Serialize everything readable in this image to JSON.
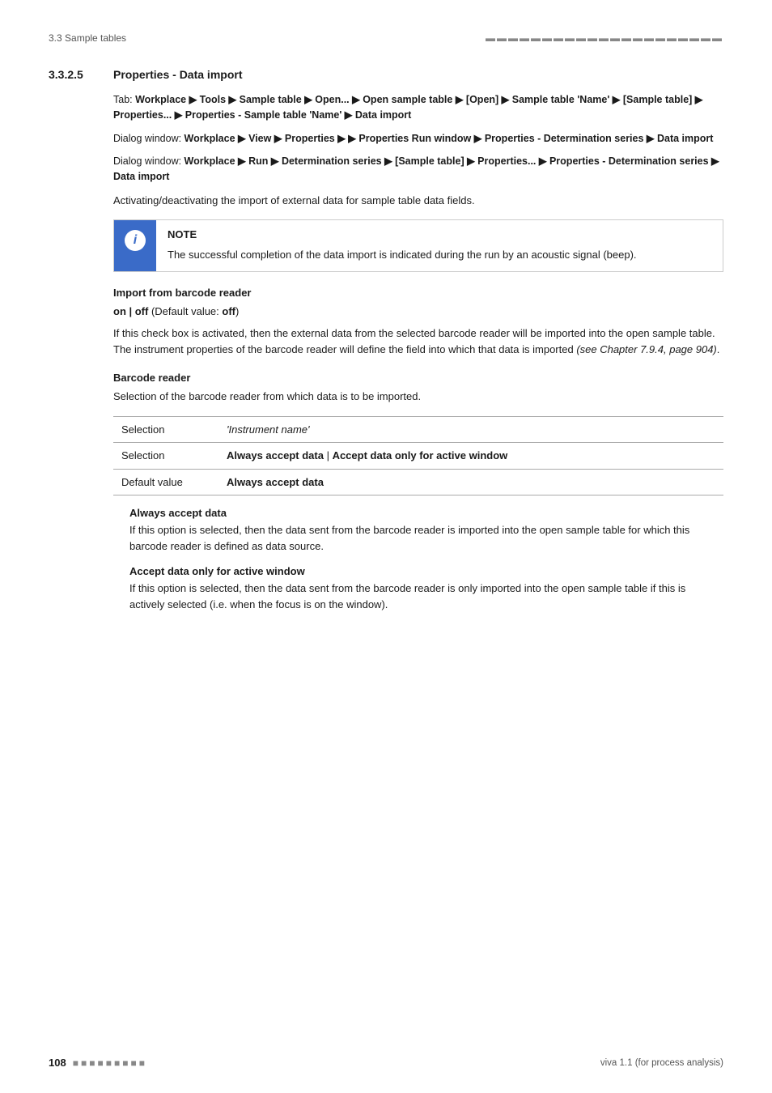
{
  "header": {
    "left": "3.3 Sample tables",
    "dots_count": 21
  },
  "section": {
    "number": "3.3.2.5",
    "title": "Properties - Data import"
  },
  "nav_paths": [
    {
      "prefix": "Tab: ",
      "content": "Workplace ▶ Tools ▶ Sample table ▶ Open... ▶ Open sample table ▶ [Open] ▶ Sample table 'Name' ▶ [Sample table] ▶ Properties... ▶ Properties - Sample table 'Name' ▶ Data import"
    },
    {
      "prefix": "Dialog window: ",
      "content": "Workplace ▶ View ▶ Properties ▶  ▶ Properties Run window ▶ Properties - Determination series ▶ Data import"
    },
    {
      "prefix": "Dialog window: ",
      "content": "Workplace ▶ Run ▶ Determination series ▶ [Sample table] ▶ Properties... ▶ Properties - Determination series ▶ Data import"
    }
  ],
  "description": "Activating/deactivating the import of external data for sample table data fields.",
  "note": {
    "title": "NOTE",
    "text": "The successful completion of the data import is indicated during the run by an acoustic signal (beep)."
  },
  "import_section": {
    "heading": "Import from barcode reader",
    "option_line": "on | off",
    "option_suffix": " (Default value: ",
    "default": "off",
    "option_close": ")",
    "description": "If this check box is activated, then the external data from the selected barcode reader will be imported into the open sample table. The instrument properties of the barcode reader will define the field into which that data is imported ",
    "see_ref": "(see Chapter 7.9.4, page 904)",
    "description_end": "."
  },
  "barcode_reader_section": {
    "heading": "Barcode reader",
    "description": "Selection of the barcode reader from which data is to be imported.",
    "table": [
      {
        "label": "Selection",
        "value": "'Instrument name'"
      },
      {
        "label": "Selection",
        "value": "Always accept data | Accept data only for active window"
      },
      {
        "label": "Default value",
        "value": "Always accept data"
      }
    ],
    "options": [
      {
        "heading": "Always accept data",
        "text": "If this option is selected, then the data sent from the barcode reader is imported into the open sample table for which this barcode reader is defined as data source."
      },
      {
        "heading": "Accept data only for active window",
        "text": "If this option is selected, then the data sent from the barcode reader is only imported into the open sample table if this is actively selected (i.e. when the focus is on the window)."
      }
    ]
  },
  "footer": {
    "page": "108",
    "dots_count": 9,
    "version": "viva 1.1 (for process analysis)"
  }
}
